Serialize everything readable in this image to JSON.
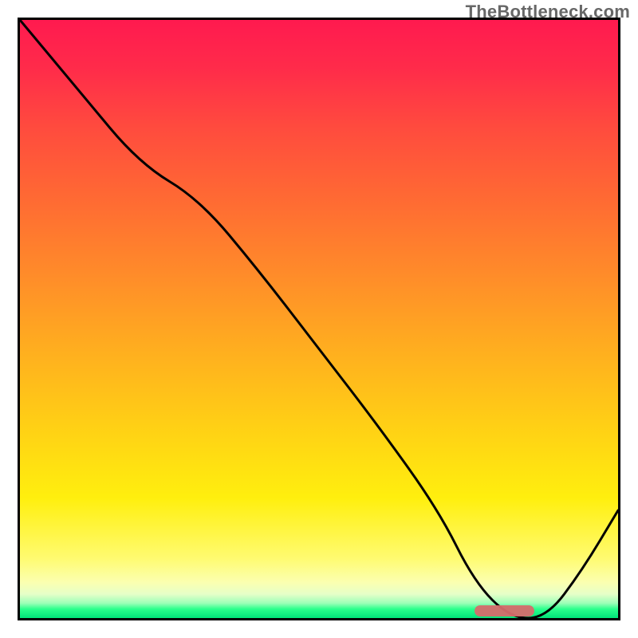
{
  "watermark": "TheBottleneck.com",
  "colors": {
    "gradient_top": "#ff1a4f",
    "gradient_mid": "#ffd015",
    "gradient_bottom": "#00e47a",
    "curve": "#000000",
    "marker": "#d66b6b",
    "frame": "#000000"
  },
  "chart_data": {
    "type": "line",
    "title": "",
    "xlabel": "",
    "ylabel": "",
    "xlim": [
      0,
      100
    ],
    "ylim": [
      0,
      100
    ],
    "grid": false,
    "legend": false,
    "series": [
      {
        "name": "bottleneck-curve",
        "x": [
          0,
          10,
          20,
          30,
          40,
          50,
          60,
          70,
          76,
          82,
          88,
          94,
          100
        ],
        "y": [
          100,
          88,
          76,
          70,
          58,
          45,
          32,
          18,
          6,
          0,
          0,
          8,
          18
        ]
      }
    ],
    "annotations": [
      {
        "name": "optimal-range-marker",
        "x_start": 76,
        "x_end": 86,
        "y": 0
      }
    ],
    "note": "No axis tick labels or numeric labels are visible in the image; x/y values above are estimated from curve geometry on a 0–100 normalized scale."
  }
}
